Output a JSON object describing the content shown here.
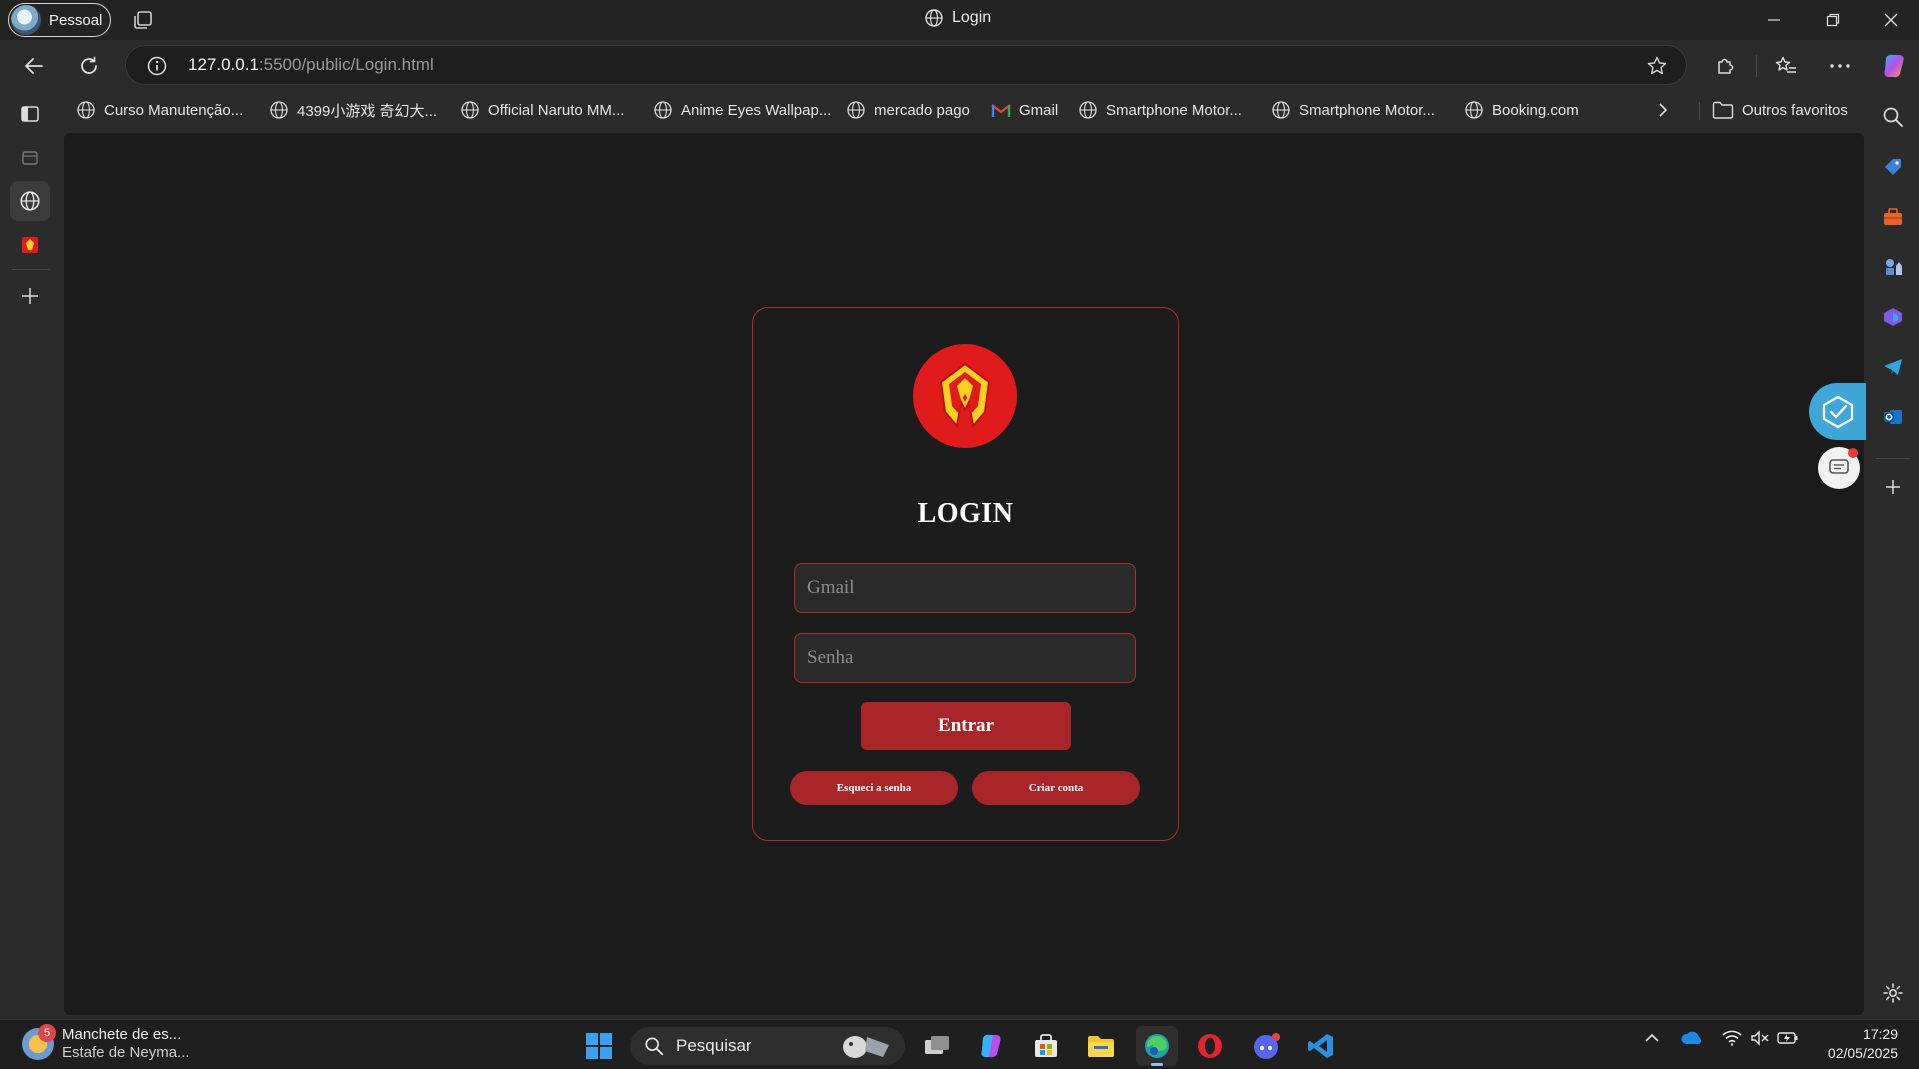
{
  "window": {
    "profile_label": "Pessoal",
    "tab_title": "Login"
  },
  "address_bar": {
    "url_host": "127.0.0.1",
    "url_rest": ":5500/public/Login.html"
  },
  "bookmarks": [
    {
      "label": "Curso Manutenção...",
      "icon": "globe-icon"
    },
    {
      "label": "4399小游戏 奇幻大...",
      "icon": "globe-icon"
    },
    {
      "label": "Official Naruto MM...",
      "icon": "globe-icon"
    },
    {
      "label": "Anime Eyes Wallpap...",
      "icon": "globe-icon"
    },
    {
      "label": "mercado pago",
      "icon": "globe-icon"
    },
    {
      "label": "Gmail",
      "icon": "gmail-icon"
    },
    {
      "label": "Smartphone Motor...",
      "icon": "globe-icon"
    },
    {
      "label": "Smartphone Motor...",
      "icon": "globe-icon"
    },
    {
      "label": "Booking.com",
      "icon": "globe-icon"
    }
  ],
  "other_favorites_label": "Outros favoritos",
  "login": {
    "title": "LOGIN",
    "email_placeholder": "Gmail",
    "password_placeholder": "Senha",
    "submit_label": "Entrar",
    "forgot_label": "Esqueci a senha",
    "create_label": "Criar conta",
    "accent_color": "#a8262a",
    "logo_color": "#e01b1b"
  },
  "taskbar": {
    "news_badge": "5",
    "news_title": "Manchete de es...",
    "news_subtitle": "Estafe de Neyma...",
    "search_label": "Pesquisar",
    "time": "17:29",
    "date": "02/05/2025"
  }
}
